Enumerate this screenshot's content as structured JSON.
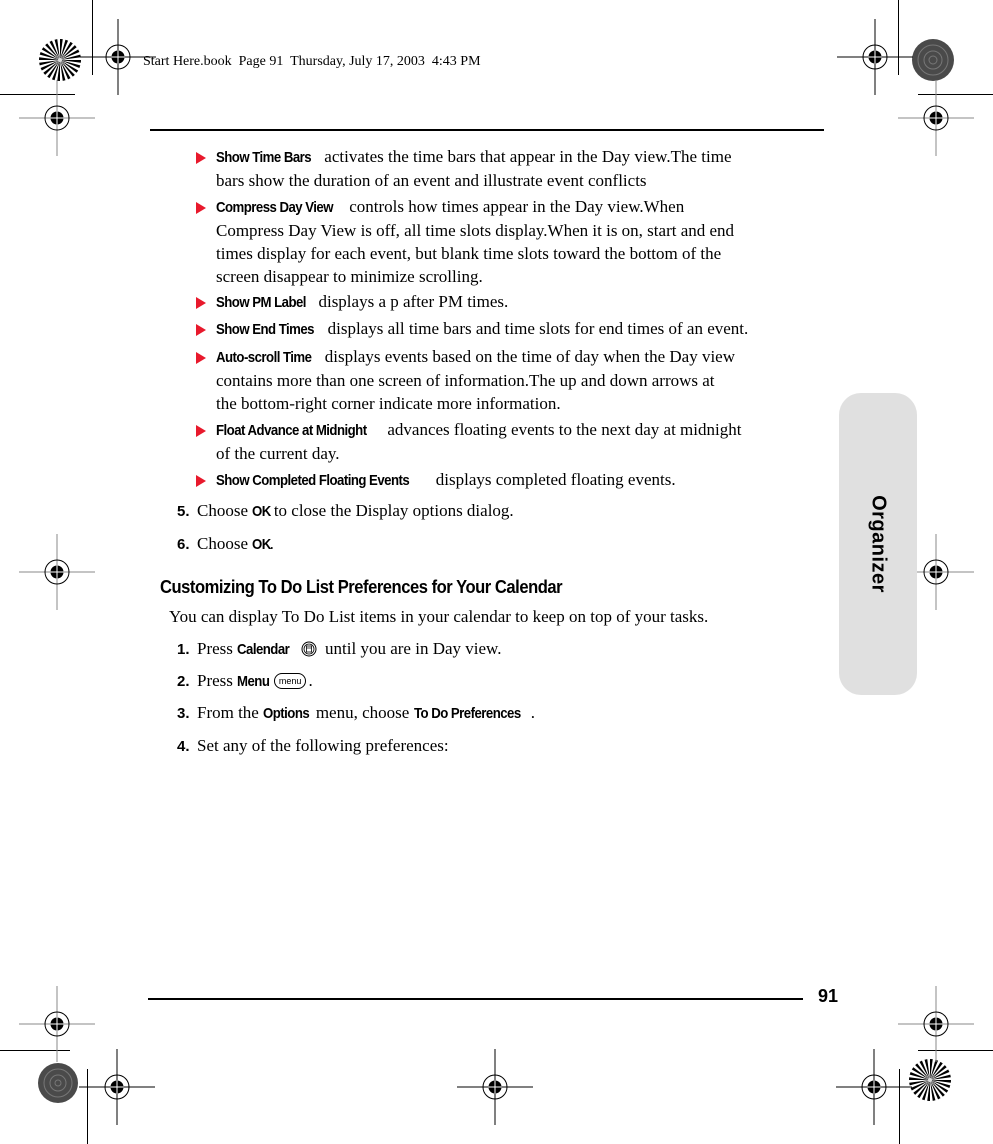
{
  "print_stamp": "Start Here.book  Page 91  Thursday, July 17, 2003  4:43 PM",
  "side_tab": {
    "label": "Organizer",
    "color": "#e0e0e0"
  },
  "page_number": "91",
  "bullet_color": "#e8192c",
  "display_options": [
    {
      "term": "Show Time Bars",
      "lines": [
        "activates the time bars that appear in the Day view.The time",
        "bars show the duration of an event and illustrate event conflicts"
      ]
    },
    {
      "term": "Compress Day View",
      "lines": [
        "controls how times appear in the Day view.When",
        "Compress Day View is off, all time slots display.When it is on, start and end",
        "times display for each event, but blank time slots toward the bottom of the",
        "screen disappear to minimize scrolling."
      ]
    },
    {
      "term": "Show PM Label",
      "lines": [
        "displays a p after PM times."
      ]
    },
    {
      "term": "Show End Times",
      "lines": [
        "displays all time bars and time slots for end times of an event."
      ]
    },
    {
      "term": "Auto-scroll Time",
      "lines": [
        "displays events based on the time of day when the Day view",
        "contains more than one screen of information.The up and down arrows at",
        "the bottom-right corner indicate more information."
      ]
    },
    {
      "term": "Float Advance at Midnight",
      "lines": [
        "advances floating events to the next day at midnight",
        "of the current day."
      ]
    },
    {
      "term": "Show Completed Floating Events",
      "lines": [
        "displays completed floating events."
      ]
    }
  ],
  "steps_a": [
    {
      "num": "5.",
      "pre": "Choose ",
      "bold": "OK",
      "post": " to close the Display options dialog."
    },
    {
      "num": "6.",
      "pre": "Choose ",
      "bold": "OK",
      "post": "."
    }
  ],
  "section": {
    "heading": "Customizing To Do List Preferences for Your Calendar",
    "intro": "You can display To Do List items in your calendar to keep on top of your tasks.",
    "steps": [
      {
        "num": "1.",
        "pre": "Press ",
        "bold": "Calendar",
        "icon": "calendar-button-icon",
        "post": " until you are in Day view."
      },
      {
        "num": "2.",
        "pre": "Press ",
        "bold": "Menu",
        "icon": "menu-button-icon",
        "icon_text": "menu",
        "post": "."
      },
      {
        "num": "3.",
        "pre": "From the ",
        "bold": "Options",
        "mid": " menu, choose ",
        "bold2": "To Do Preferences",
        "post": "."
      },
      {
        "num": "4.",
        "pre": "Set any of the following preferences:"
      }
    ]
  }
}
